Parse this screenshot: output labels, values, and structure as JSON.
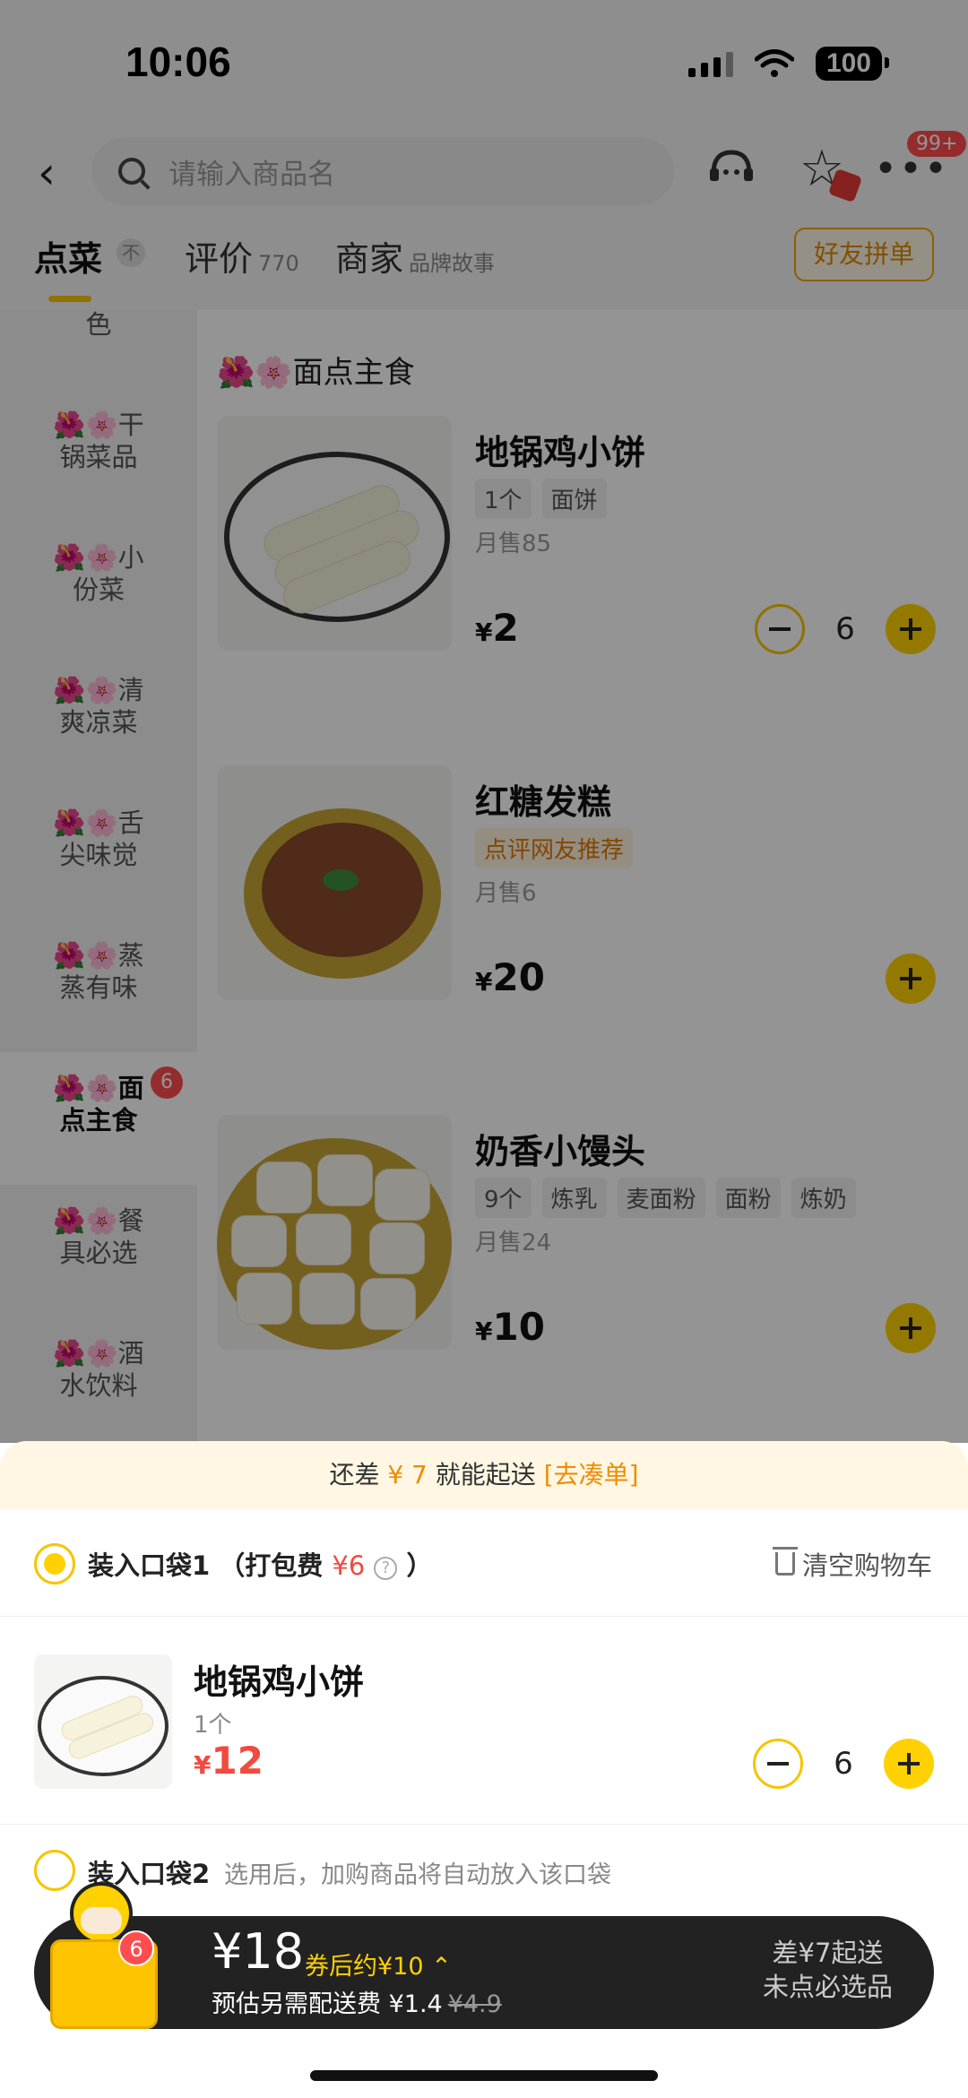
{
  "status_bar": {
    "time": "10:06",
    "battery": "100"
  },
  "header": {
    "search_placeholder": "请输入商品名",
    "more_badge": "99+"
  },
  "tabs": {
    "menu": "点菜",
    "menu_badge": "不",
    "reviews": "评价",
    "reviews_count": "770",
    "merchant": "商家",
    "merchant_sub": "品牌故事",
    "friends_order": "好友拼单"
  },
  "sidebar": {
    "flowers": "🌺🌸",
    "items": [
      {
        "label": "色"
      },
      {
        "label1": "干",
        "label2": "锅菜品"
      },
      {
        "label1": "小",
        "label2": "份菜"
      },
      {
        "label1": "清",
        "label2": "爽凉菜"
      },
      {
        "label1": "舌",
        "label2": "尖味觉"
      },
      {
        "label1": "蒸",
        "label2": "蒸有味"
      },
      {
        "label1": "面",
        "label2": "点主食",
        "badge": "6"
      },
      {
        "label1": "餐",
        "label2": "具必选"
      },
      {
        "label1": "酒",
        "label2": "水饮料"
      }
    ]
  },
  "section": {
    "title": "🌺🌸面点主食"
  },
  "products": [
    {
      "name": "地锅鸡小饼",
      "tags": [
        "1个",
        "面饼"
      ],
      "sales": "月售85",
      "currency": "¥",
      "price": "2",
      "qty": "6"
    },
    {
      "name": "红糖发糕",
      "tags": [
        "点评网友推荐"
      ],
      "sales": "月售6",
      "currency": "¥",
      "price": "20"
    },
    {
      "name": "奶香小馒头",
      "tags": [
        "9个",
        "炼乳",
        "麦面粉",
        "面粉",
        "炼奶"
      ],
      "sales": "月售24",
      "currency": "¥",
      "price": "10"
    }
  ],
  "cart": {
    "notice_pre": "还差 ",
    "notice_amount": "¥ 7",
    "notice_mid": " 就能起送 ",
    "notice_link": "[去凑单]",
    "bag1_label": "装入口袋1 （打包费 ",
    "bag1_fee": "¥6",
    "bag1_close": " ）",
    "clear_label": "清空购物车",
    "item": {
      "name": "地锅鸡小饼",
      "spec": "1个",
      "currency": "¥",
      "price": "12",
      "qty": "6"
    },
    "bag2_label": "装入口袋2",
    "bag2_desc": "选用后，加购商品将自动放入该口袋"
  },
  "checkout": {
    "mascot_badge": "6",
    "total": "¥18",
    "coupon_note": "券后约¥10 ⌃",
    "fee_label": "预估另需配送费 ¥1.4",
    "fee_original": "¥4.9",
    "diff_line1": "差¥7起送",
    "diff_line2": "未点必选品"
  },
  "colors": {
    "accent": "#ffd100",
    "price_red": "#f04b3f",
    "notice_orange": "#f08c00"
  }
}
